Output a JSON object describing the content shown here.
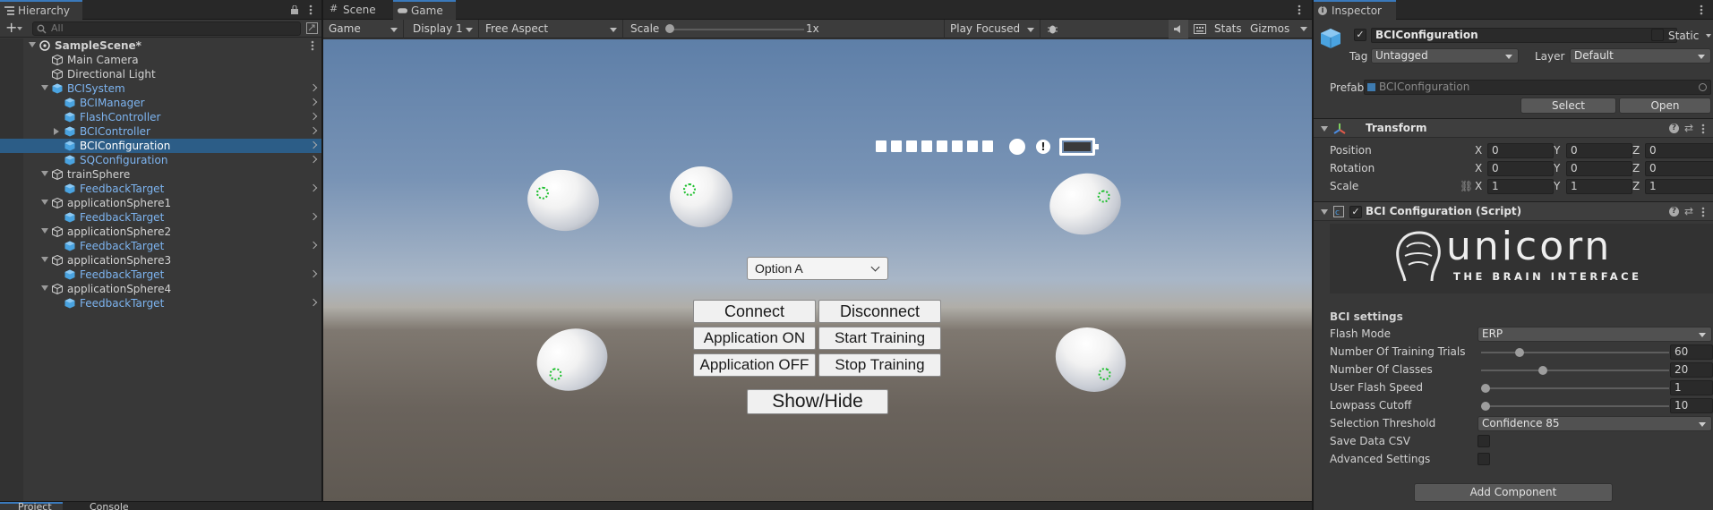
{
  "hierarchy": {
    "tab_label": "Hierarchy",
    "search_placeholder": "All",
    "add_label": "+",
    "items": [
      {
        "label": "SampleScene*",
        "level": 0,
        "kind": "scene"
      },
      {
        "label": "Main Camera",
        "level": 1,
        "kind": "object"
      },
      {
        "label": "Directional Light",
        "level": 1,
        "kind": "object"
      },
      {
        "label": "BCISystem",
        "level": 1,
        "kind": "prefab"
      },
      {
        "label": "BCIManager",
        "level": 2,
        "kind": "prefab"
      },
      {
        "label": "FlashController",
        "level": 2,
        "kind": "prefab"
      },
      {
        "label": "BCIController",
        "level": 2,
        "kind": "prefab"
      },
      {
        "label": "BCIConfiguration",
        "level": 2,
        "kind": "prefab",
        "selected": true
      },
      {
        "label": "SQConfiguration",
        "level": 2,
        "kind": "prefab"
      },
      {
        "label": "trainSphere",
        "level": 1,
        "kind": "object"
      },
      {
        "label": "FeedbackTarget",
        "level": 2,
        "kind": "prefab"
      },
      {
        "label": "applicationSphere1",
        "level": 1,
        "kind": "object"
      },
      {
        "label": "FeedbackTarget",
        "level": 2,
        "kind": "prefab"
      },
      {
        "label": "applicationSphere2",
        "level": 1,
        "kind": "object"
      },
      {
        "label": "FeedbackTarget",
        "level": 2,
        "kind": "prefab"
      },
      {
        "label": "applicationSphere3",
        "level": 1,
        "kind": "object"
      },
      {
        "label": "FeedbackTarget",
        "level": 2,
        "kind": "prefab"
      },
      {
        "label": "applicationSphere4",
        "level": 1,
        "kind": "object"
      },
      {
        "label": "FeedbackTarget",
        "level": 2,
        "kind": "prefab"
      }
    ]
  },
  "view_tabs": {
    "scene": "Scene",
    "game": "Game"
  },
  "game_toolbar": {
    "mode": "Game",
    "display": "Display 1",
    "aspect": "Free Aspect",
    "scale_label": "Scale",
    "scale_value": "1x",
    "play_mode": "Play Focused",
    "stats": "Stats",
    "gizmos": "Gizmos"
  },
  "game_ui": {
    "dropdown_value": "Option A",
    "buttons": {
      "connect": "Connect",
      "disconnect": "Disconnect",
      "application_on": "Application ON",
      "start_training": "Start Training",
      "application_off": "Application OFF",
      "stop_training": "Stop Training",
      "show_hide": "Show/Hide"
    },
    "signal_squares": 8,
    "status_icon": "!"
  },
  "bottom_tabs": {
    "project": "Project",
    "console": "Console"
  },
  "inspector": {
    "tab_label": "Inspector",
    "object_name": "BCIConfiguration",
    "static_label": "Static",
    "tag_label": "Tag",
    "tag_value": "Untagged",
    "layer_label": "Layer",
    "layer_value": "Default",
    "prefab_label": "Prefab",
    "prefab_value": "BCIConfiguration",
    "select_button": "Select",
    "open_button": "Open",
    "transform": {
      "title": "Transform",
      "rows": [
        {
          "label": "Position",
          "x": "0",
          "y": "0",
          "z": "0"
        },
        {
          "label": "Rotation",
          "x": "0",
          "y": "0",
          "z": "0"
        },
        {
          "label": "Scale",
          "x": "1",
          "y": "1",
          "z": "1"
        }
      ],
      "axis_x": "X",
      "axis_y": "Y",
      "axis_z": "Z"
    },
    "script": {
      "title": "BCI Configuration (Script)",
      "logo_text": "unicorn",
      "logo_subtitle": "THE BRAIN INTERFACE",
      "section": "BCI settings",
      "fields": [
        {
          "label": "Flash Mode",
          "type": "popup",
          "value": "ERP"
        },
        {
          "label": "Number Of Training Trials",
          "type": "slider",
          "value": "60",
          "fraction": 0.19
        },
        {
          "label": "Number Of Classes",
          "type": "slider",
          "value": "20",
          "fraction": 0.32
        },
        {
          "label": "User Flash Speed",
          "type": "slider",
          "value": "1",
          "fraction": 0.0
        },
        {
          "label": "Lowpass Cutoff",
          "type": "slider",
          "value": "10",
          "fraction": 0.0
        },
        {
          "label": "Selection Threshold",
          "type": "popup",
          "value": "Confidence 85"
        },
        {
          "label": "Save Data CSV",
          "type": "checkbox",
          "value": false
        },
        {
          "label": "Advanced Settings",
          "type": "checkbox",
          "value": false
        }
      ]
    },
    "add_component": "Add Component"
  },
  "colors": {
    "selection": "#2c5d87",
    "prefab_text": "#7db4f0",
    "feedback_target": "#1fbf2f",
    "tab_accent": "#3a79bb"
  }
}
